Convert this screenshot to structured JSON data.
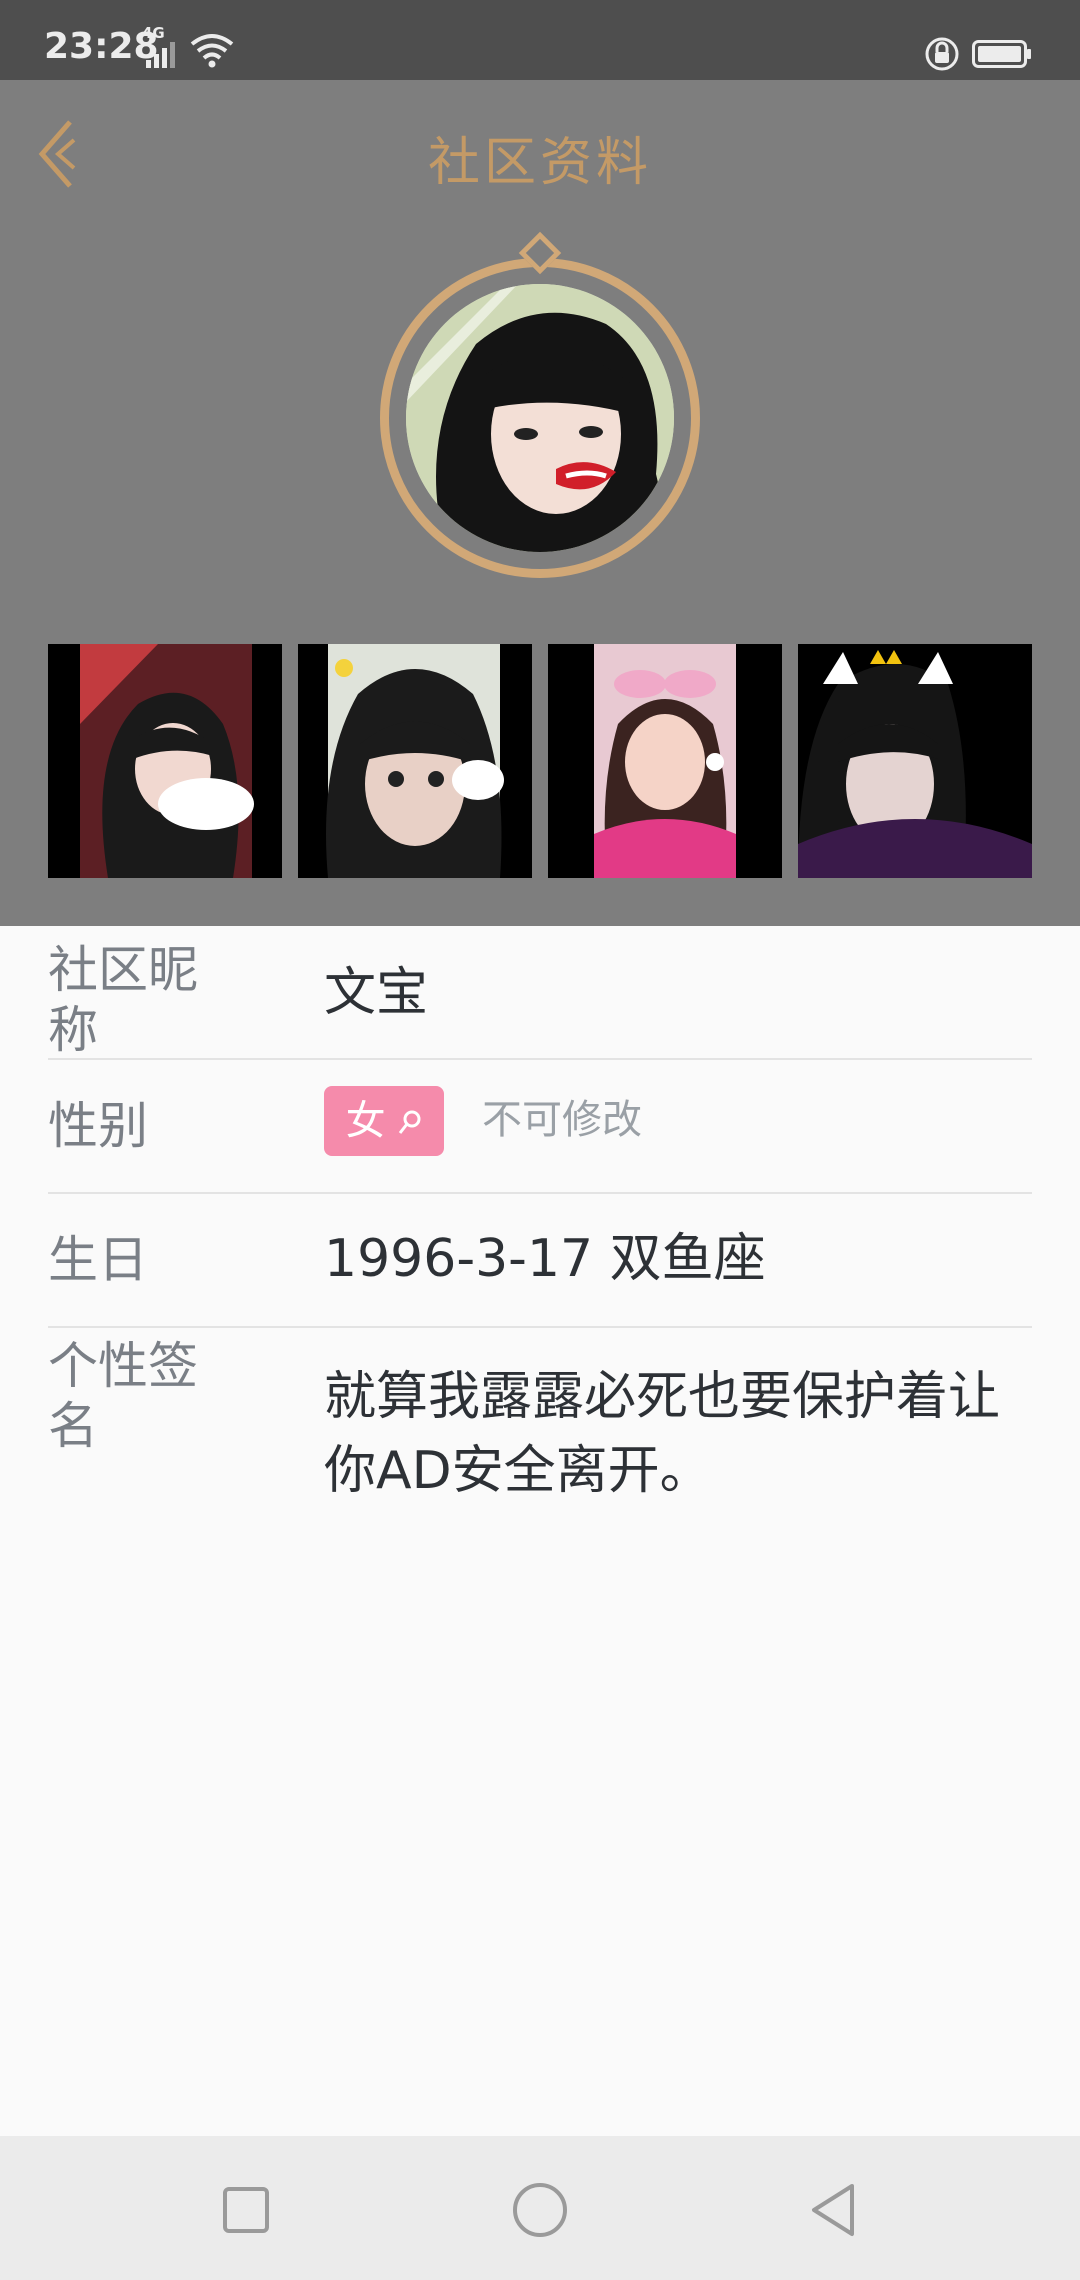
{
  "status": {
    "time": "23:28",
    "network": "4G"
  },
  "header": {
    "title": "社区资料",
    "back_icon": "chevron-left-icon"
  },
  "avatar": {
    "description_icon": "avatar-icon"
  },
  "photos": [
    "photo-1",
    "photo-2",
    "photo-3",
    "photo-4"
  ],
  "profile": {
    "nickname_label": "社区昵称",
    "nickname_value": "文宝",
    "gender_label": "性别",
    "gender_value": "女",
    "gender_note": "不可修改",
    "birthday_label": "生日",
    "birthday_value": "1996-3-17 双鱼座",
    "signature_label": "个性签名",
    "signature_value": "就算我露露必死也要保护着让你AD安全离开。"
  },
  "colors": {
    "accent": "#c49a66",
    "header_bg": "#7e7e7e",
    "badge": "#f58bab"
  }
}
